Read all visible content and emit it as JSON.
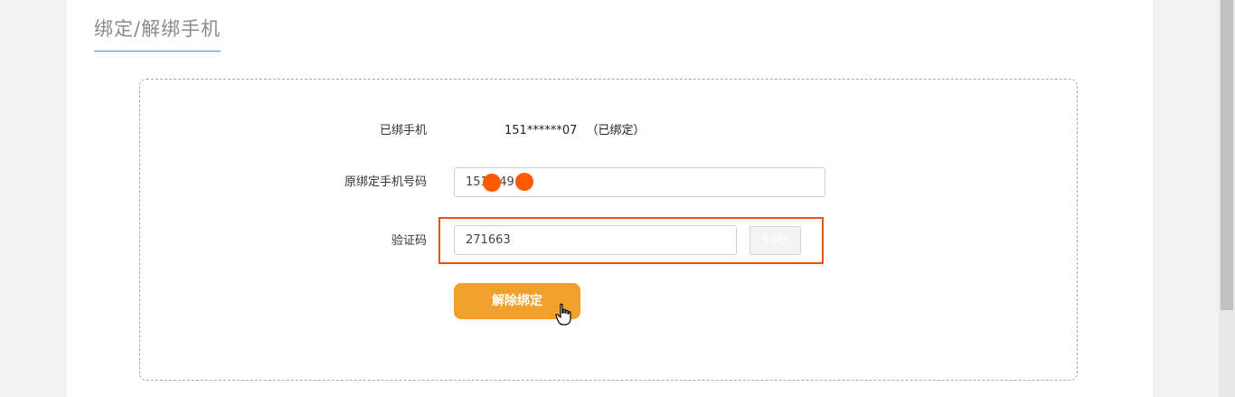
{
  "header": {
    "title": "绑定/解绑手机"
  },
  "form": {
    "bound_phone_label": "已绑手机",
    "bound_phone_value": "151******07",
    "bound_status": "（已绑定）",
    "original_phone_label": "原绑定手机号码",
    "original_phone_value": "151 249 07",
    "code_label": "验证码",
    "code_value": "271663",
    "countdown_label": "99秒",
    "submit_label": "解除绑定"
  },
  "colors": {
    "accent": "#f0a02c",
    "highlight": "#e8540f",
    "title_underline": "#4a90d9",
    "redaction": "#ff5a00"
  }
}
